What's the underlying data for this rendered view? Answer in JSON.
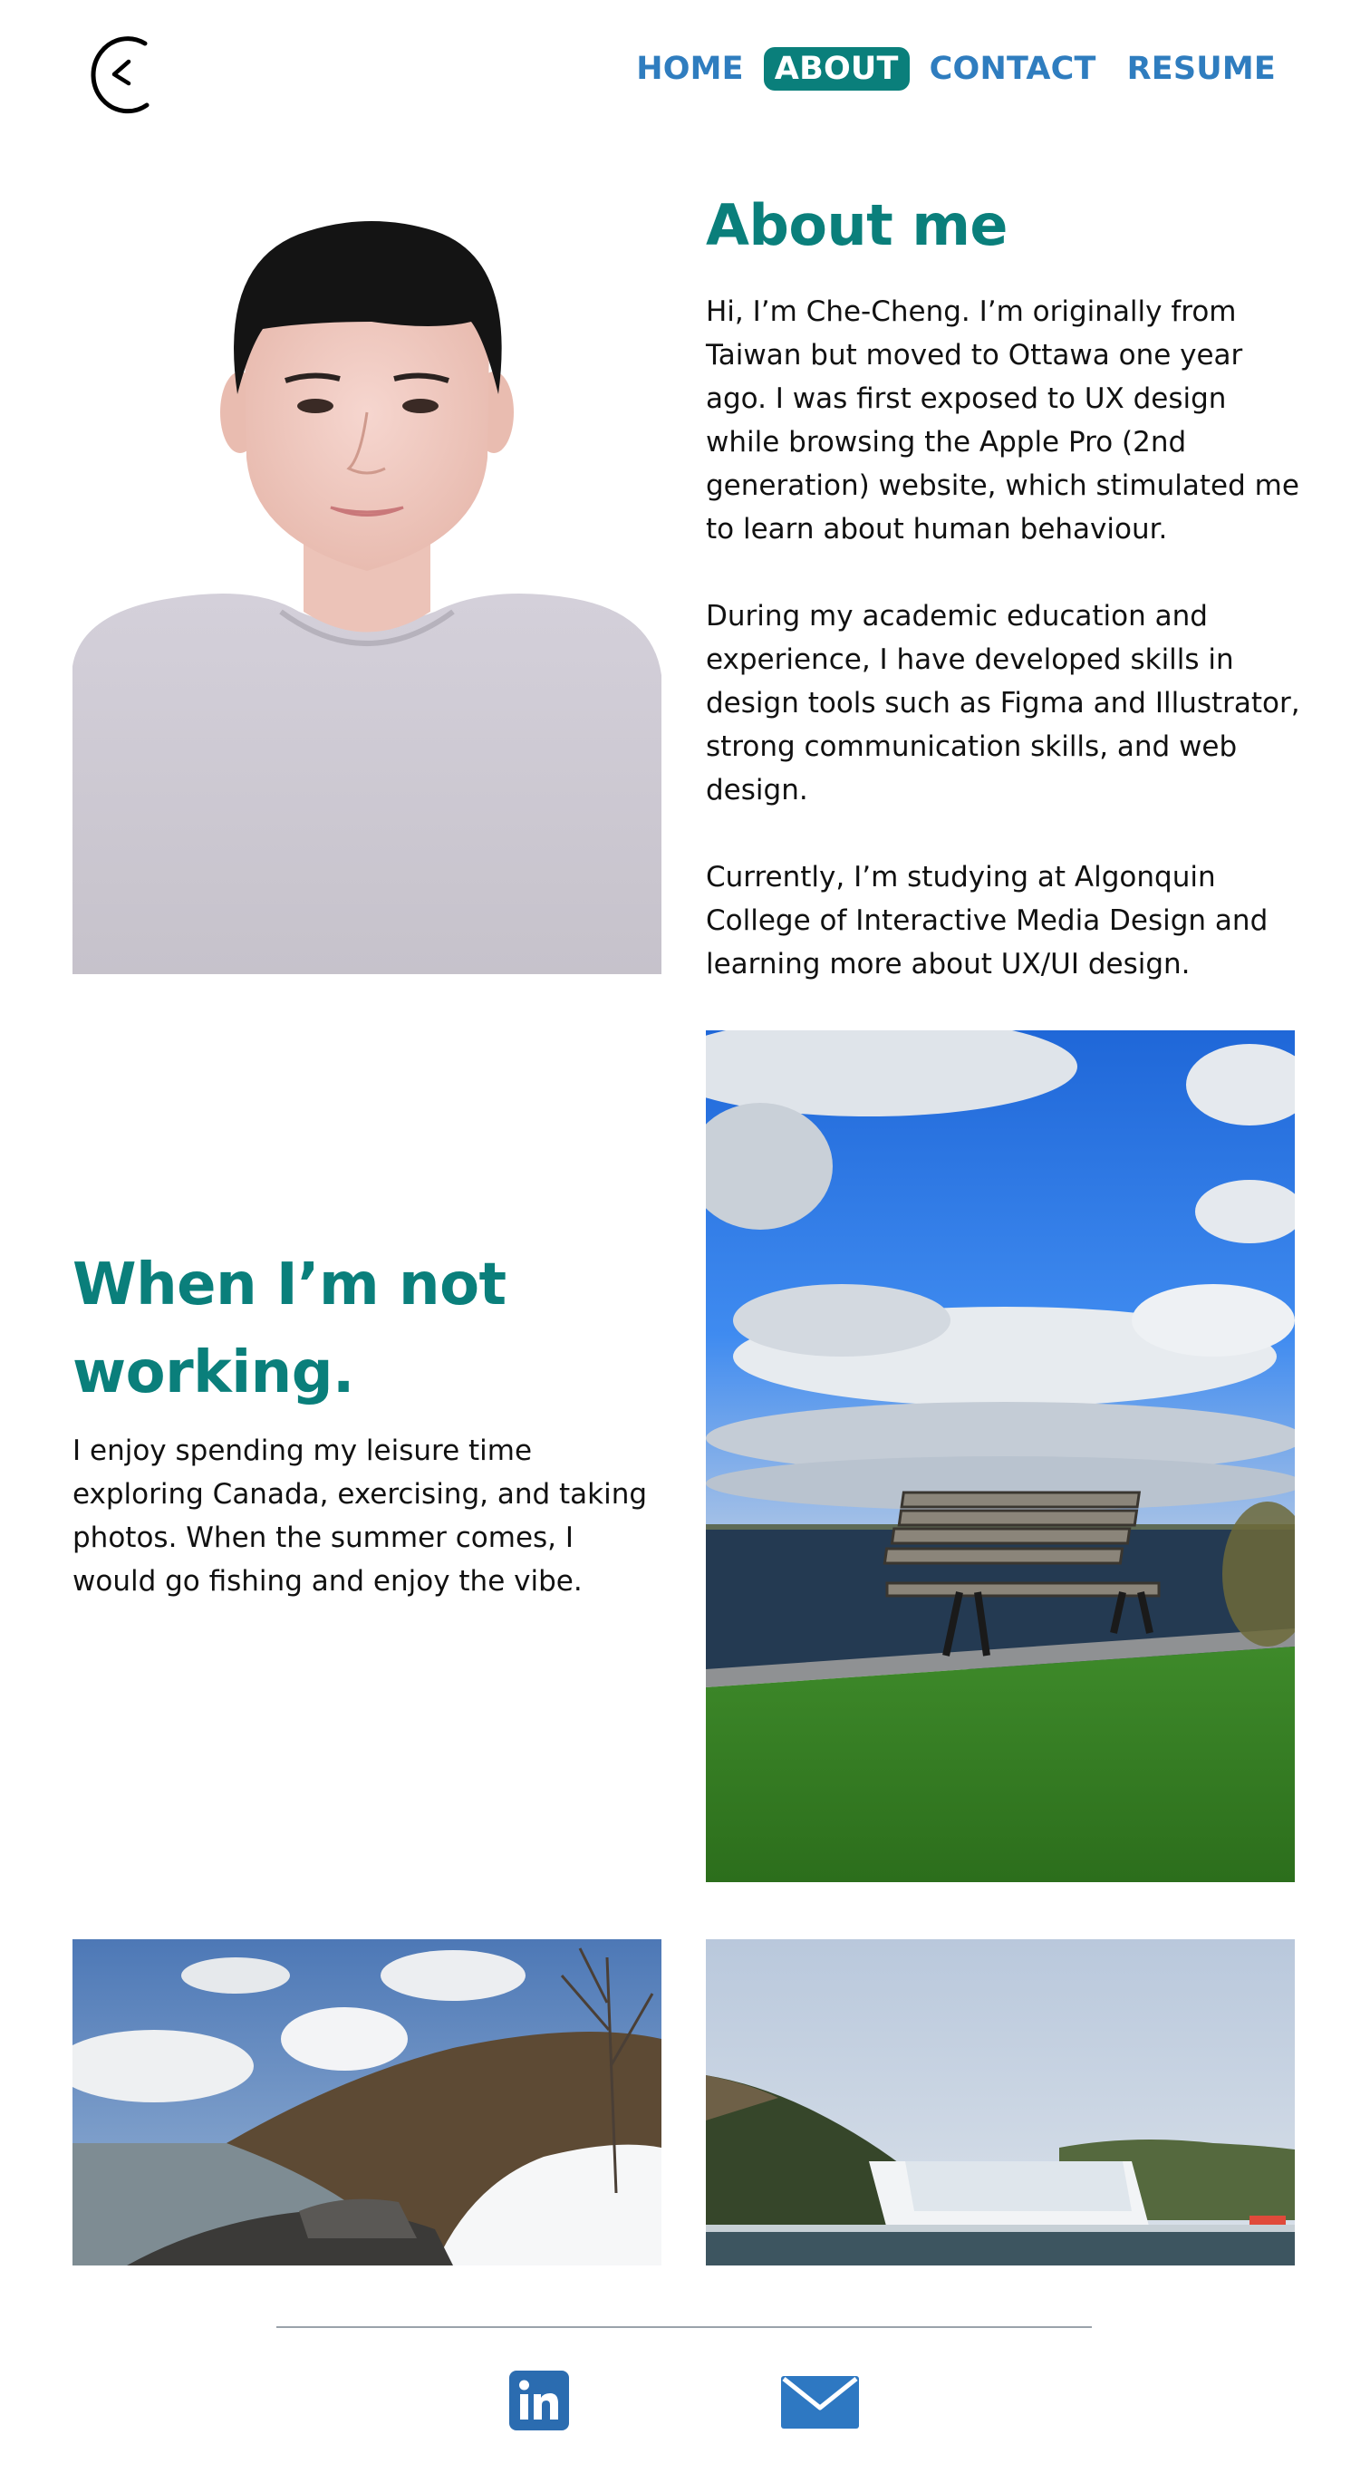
{
  "header": {
    "logo_icon": "clock-logo-icon",
    "nav": [
      {
        "label": "HOME",
        "active": false
      },
      {
        "label": "ABOUT",
        "active": true
      },
      {
        "label": "CONTACT",
        "active": false
      },
      {
        "label": "RESUME",
        "active": false
      }
    ]
  },
  "about": {
    "title": "About me",
    "paragraphs": [
      "Hi, I’m Che-Cheng. I’m originally from Taiwan but moved to Ottawa one year ago. I was first exposed to UX design while browsing the Apple Pro (2nd generation) website, which stimulated me to learn about human behaviour.",
      "During my academic education and experience, I have developed skills in design tools such as Figma and Illustrator, strong communication skills, and web design.",
      "Currently, I’m studying at Algonquin College of Interactive Media Design and learning more about UX/UI design."
    ]
  },
  "leisure": {
    "title": "When I’m not working.",
    "text": "I enjoy spending my leisure time exploring Canada, exercising, and taking photos. When the summer comes, I would go fishing and enjoy the vibe."
  },
  "footer": {
    "icons": [
      "linkedin-icon",
      "mail-icon"
    ]
  },
  "colors": {
    "accent_teal": "#0a7f7b",
    "nav_blue": "#2f7dbf",
    "linkedin_blue": "#2b6cb0",
    "mail_blue": "#2e78c2"
  }
}
